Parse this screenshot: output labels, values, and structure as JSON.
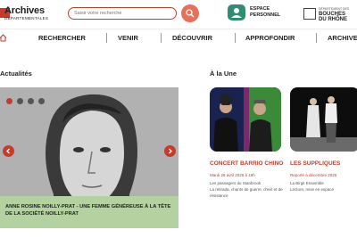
{
  "header": {
    "logo_title": "Archives",
    "logo_subtitle": "DÉPARTEMENTALES",
    "search_placeholder": "Saisir votre recherche",
    "espace_label_1": "ESPACE",
    "espace_label_2": "PERSONNEL",
    "dept_small": "DÉPARTEMENT DES",
    "dept_name_1": "BOUCHES",
    "dept_name_2": "DU RHÔNE"
  },
  "nav": {
    "items": [
      "RECHERCHER",
      "VENIR",
      "DÉCOUVRIR",
      "APPROFONDIR",
      "ARCHIVE"
    ]
  },
  "actualites": {
    "title": "Actualités",
    "caption": "ANNE ROSINE NOILLY-PRAT - UNE FEMME GÉNÉREUSE À LA TÊTE DE LA SOCIÉTÉ NOILLY-PRAT"
  },
  "une": {
    "title": "À la Une",
    "cards": [
      {
        "title": "CONCERT BARRIO CHINO",
        "date": "Mardi 28 avril 2026 à 19h",
        "desc": "Les passagers du Stanbrook\nLa retirada, chants de guerre, d'exil et de résistance"
      },
      {
        "title": "LES SUPPLIQUES",
        "date": "Reporté à décembre 2026",
        "desc": "La Birgit Ensemble\nLecture, mise en espace"
      }
    ]
  },
  "colors": {
    "accent": "#c63c2a",
    "caption_bg": "#b3d29f",
    "espace_green": "#2e8d74"
  }
}
